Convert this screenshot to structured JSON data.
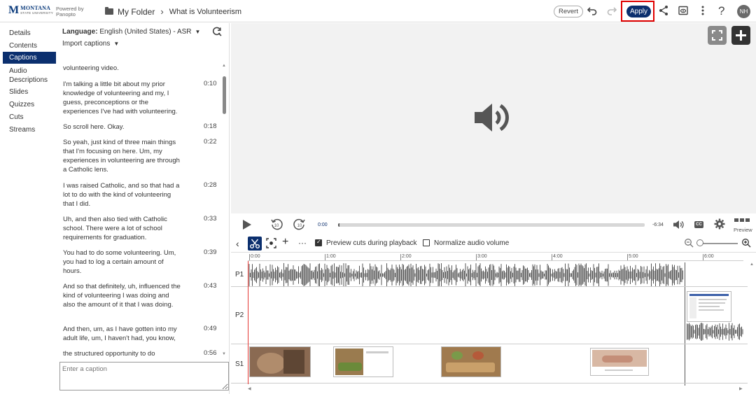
{
  "header": {
    "logo_main": "MONTANA",
    "logo_sub": "STATE UNIVERSITY",
    "powered_by": "Powered by",
    "powered_brand": "Panopto",
    "breadcrumb_folder": "My Folder",
    "breadcrumb_title": "What is Volunteerism",
    "revert_label": "Revert",
    "apply_label": "Apply",
    "avatar_initials": "NH"
  },
  "nav": {
    "items": [
      "Details",
      "Contents",
      "Captions",
      "Audio Descriptions",
      "Slides",
      "Quizzes",
      "Cuts",
      "Streams"
    ],
    "active": "Captions"
  },
  "captions_panel": {
    "language_label": "Language:",
    "language_value": "English (United States) - ASR",
    "import_label": "Import captions",
    "input_placeholder": "Enter a caption",
    "entries": [
      {
        "text": "volunteering video.",
        "time": ""
      },
      {
        "text": "I'm talking a little bit about my prior knowledge of volunteering and my, I guess, preconceptions or the experiences I've had with volunteering.",
        "time": "0:10"
      },
      {
        "text": "So scroll here. Okay.",
        "time": "0:18"
      },
      {
        "text": "So yeah, just kind of three main things that I'm focusing on here. Um, my experiences in volunteering are through a Catholic lens.",
        "time": "0:22"
      },
      {
        "text": "I was raised Catholic, and so that had a lot to do with the kind of volunteering that I did.",
        "time": "0:28"
      },
      {
        "text": "Uh, and then also tied with Catholic school. There were a lot of school requirements for graduation.",
        "time": "0:33"
      },
      {
        "text": "You had to do some volunteering. Um, you had to log a certain amount of hours.",
        "time": "0:39"
      },
      {
        "text": "And so that definitely, uh, influenced the kind of volunteering I was doing and also the amount of it that I was doing.",
        "time": "0:43"
      },
      {
        "text": "And then, um, as I have gotten into my adult life, um, I haven't had, you know,",
        "time": "0:49"
      },
      {
        "text": "the structured opportunity to do",
        "time": "0:56"
      }
    ]
  },
  "player": {
    "current_time": "0:00",
    "remaining_time": "-6:34",
    "progress": 0.0,
    "preview_label": "Preview",
    "skip_back_label": "10",
    "skip_fwd_label": "10",
    "cc_label": "CC"
  },
  "editor": {
    "preview_cuts_label": "Preview cuts during playback",
    "preview_cuts_checked": true,
    "normalize_label": "Normalize audio volume",
    "normalize_checked": false
  },
  "timeline": {
    "ticks": [
      "0:00",
      "1:00",
      "2:00",
      "3:00",
      "4:00",
      "5:00",
      "6:00"
    ],
    "tracks": [
      "P1",
      "P2",
      "S1"
    ]
  },
  "colors": {
    "brand_navy": "#0b2f6e",
    "highlight_red": "#e00000",
    "playhead_red": "#e53935"
  }
}
